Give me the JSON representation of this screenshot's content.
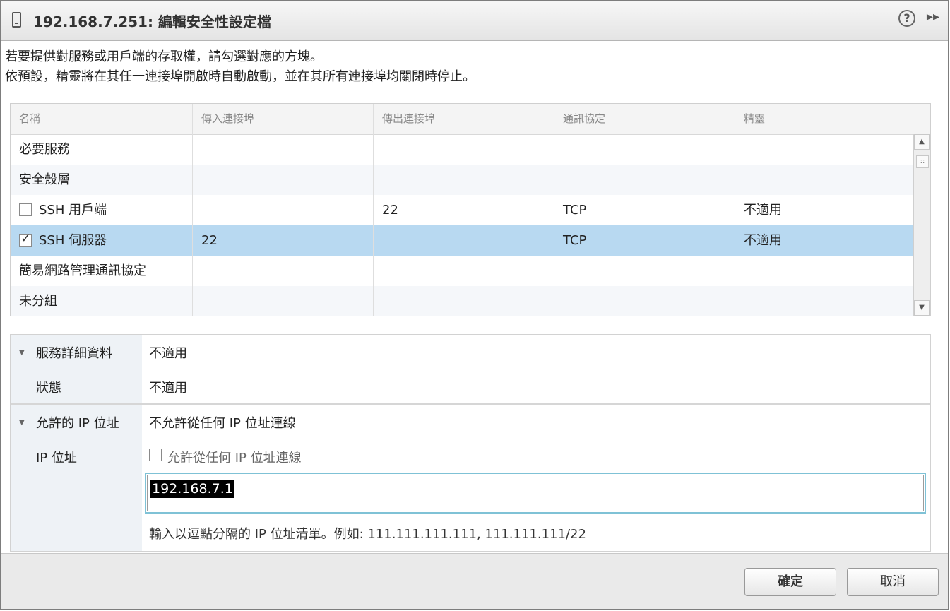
{
  "window": {
    "title": "192.168.7.251: 編輯安全性設定檔"
  },
  "intro": {
    "line1": "若要提供對服務或用戶端的存取權，請勾選對應的方塊。",
    "line2": "依預設，精靈將在其任一連接埠開啟時自動啟動，並在其所有連接埠均關閉時停止。"
  },
  "grid": {
    "columns": [
      "名稱",
      "傳入連接埠",
      "傳出連接埠",
      "通訊協定",
      "精靈"
    ],
    "rows": [
      {
        "name": "必要服務",
        "in": "",
        "out": "",
        "proto": "",
        "daemon": "",
        "checkbox": false
      },
      {
        "name": "安全殼層",
        "in": "",
        "out": "",
        "proto": "",
        "daemon": "",
        "checkbox": false
      },
      {
        "name": "SSH 用戶端",
        "in": "",
        "out": "22",
        "proto": "TCP",
        "daemon": "不適用",
        "checkbox": true,
        "checked": false
      },
      {
        "name": "SSH 伺服器",
        "in": "22",
        "out": "",
        "proto": "TCP",
        "daemon": "不適用",
        "checkbox": true,
        "checked": true,
        "selected": true
      },
      {
        "name": "簡易網路管理通訊協定",
        "in": "",
        "out": "",
        "proto": "",
        "daemon": "",
        "checkbox": false
      },
      {
        "name": "未分組",
        "in": "",
        "out": "",
        "proto": "",
        "daemon": "",
        "checkbox": false
      }
    ]
  },
  "details": {
    "service_label": "服務詳細資料",
    "service_value": "不適用",
    "status_label": "狀態",
    "status_value": "不適用",
    "allowed_label": "允許的 IP 位址",
    "allowed_value": "不允許從任何 IP 位址連線",
    "ip_label": "IP 位址",
    "allow_any_label": "允許從任何 IP 位址連線",
    "ip_input_value": "192.168.7.1",
    "hint": "輸入以逗點分隔的 IP 位址清單。例如: 111.111.111.111, 111.111.111/22"
  },
  "footer": {
    "ok": "確定",
    "cancel": "取消"
  },
  "colors": {
    "selection": "#b8d9f1",
    "focus": "#7fc2d6"
  }
}
